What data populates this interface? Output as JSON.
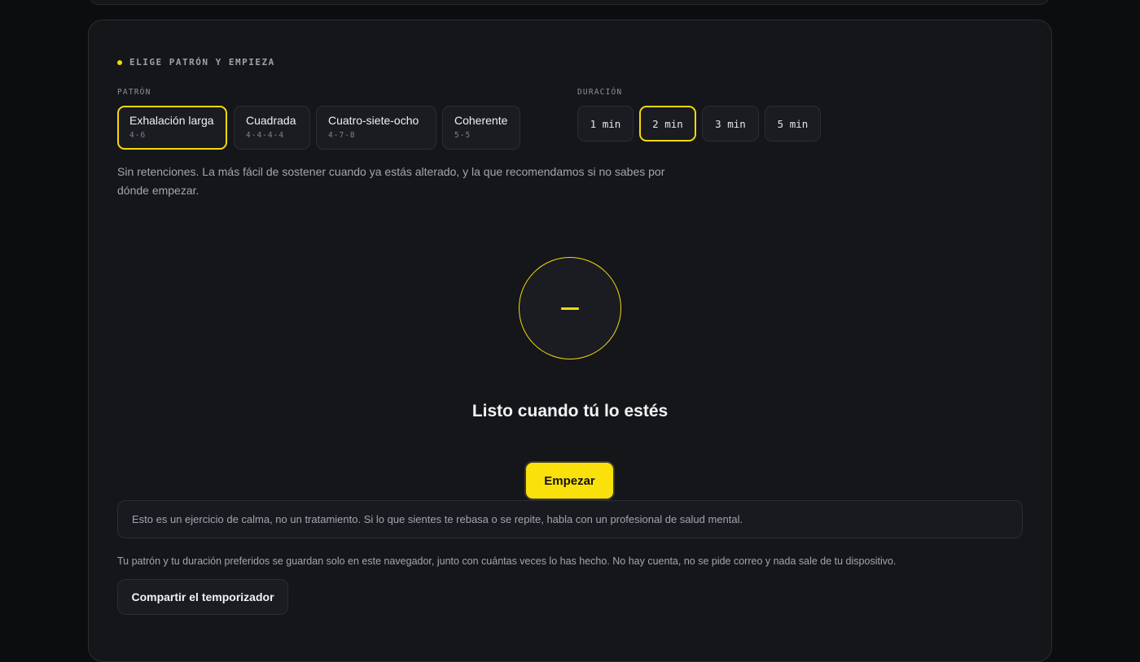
{
  "section": {
    "label": "ELIGE PATRÓN Y EMPIEZA"
  },
  "pattern": {
    "label": "PATRÓN",
    "options": [
      {
        "name": "Exhalación larga",
        "sub": "4-6",
        "selected": true
      },
      {
        "name": "Cuadrada",
        "sub": "4-4-4-4",
        "selected": false
      },
      {
        "name": "Cuatro-siete-ocho",
        "sub": "4-7-8",
        "selected": false
      },
      {
        "name": "Coherente",
        "sub": "5-5",
        "selected": false
      }
    ],
    "description": "Sin retenciones. La más fácil de sostener cuando ya estás alterado, y la que recomendamos si no sabes por dónde empezar."
  },
  "duration": {
    "label": "DURACIÓN",
    "options": [
      {
        "label": "1 min",
        "selected": false
      },
      {
        "label": "2 min",
        "selected": true
      },
      {
        "label": "3 min",
        "selected": false
      },
      {
        "label": "5 min",
        "selected": false
      }
    ]
  },
  "breath": {
    "ready_text": "Listo cuando tú lo estés"
  },
  "actions": {
    "start_label": "Empezar",
    "share_label": "Compartir el temporizador"
  },
  "notice": "Esto es un ejercicio de calma, no un tratamiento. Si lo que sientes te rebasa o se repite, habla con un profesional de salud mental.",
  "privacy": "Tu patrón y tu duración preferidos se guardan solo en este navegador, junto con cuántas veces lo has hecho. No hay cuenta, no se pide correo y nada sale de tu dispositivo.",
  "colors": {
    "accent": "#f5d90a",
    "panel": "#14161a",
    "background": "#0c0d0f"
  }
}
